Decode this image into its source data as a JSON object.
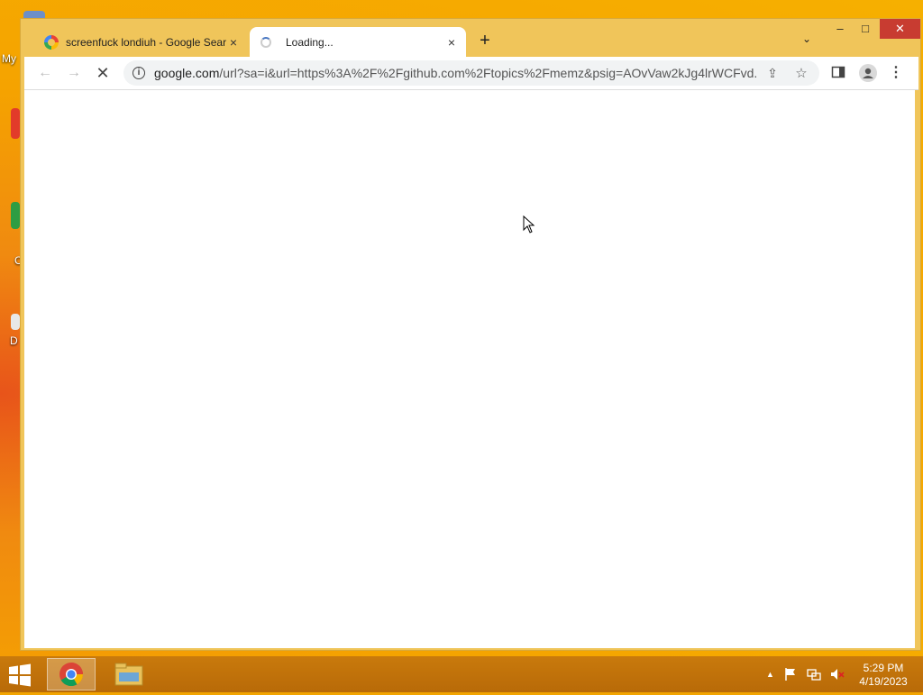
{
  "desktop": {
    "icons": [
      {
        "label": "My"
      },
      {
        "label": "C"
      },
      {
        "label": "D"
      }
    ]
  },
  "browser": {
    "tabs": [
      {
        "title": "screenfuck londiuh - Google Search",
        "close": "×",
        "active": false
      },
      {
        "title": "Loading...",
        "close": "×",
        "active": true
      }
    ],
    "new_tab": "+",
    "tab_search": "⌄",
    "window_controls": {
      "minimize": "–",
      "maximize": "□",
      "close": "✕"
    },
    "toolbar": {
      "back": "←",
      "forward": "→",
      "stop": "✕",
      "url_domain": "google.com",
      "url_rest": "/url?sa=i&url=https%3A%2F%2Fgithub.com%2Ftopics%2Fmemz&psig=AOvVaw2kJg4lrWCFvd...",
      "info": "i",
      "share": "⇪",
      "star": "☆",
      "menu": "⋮"
    }
  },
  "taskbar": {
    "tray_expand": "▲",
    "clock_time": "5:29 PM",
    "clock_date": "4/19/2023"
  },
  "colors": {
    "window_frame": "#f0c55a",
    "close_red": "#c83c31",
    "desktop_orange": "#f5a300",
    "taskbar": "#c07410"
  }
}
